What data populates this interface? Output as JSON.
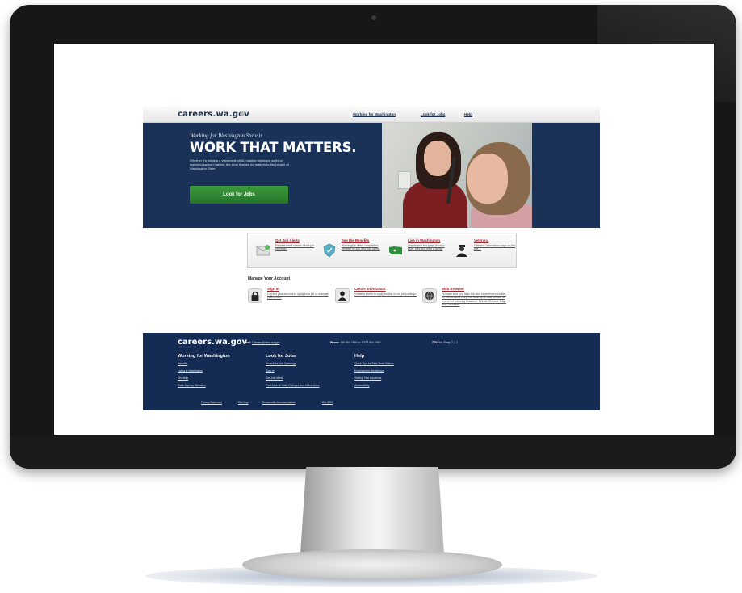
{
  "site": {
    "logo": "careers.wa.gov",
    "nav": [
      "Working for Washington",
      "Look for Jobs",
      "Help"
    ],
    "hero": {
      "subtitle": "Working for Washington State is",
      "title": "WORK THAT MATTERS.",
      "text": "Whether it's helping a vulnerable child, making highways safer or restoring salmon habitat, the work that we do matters to the people of Washington State.",
      "cta": "Look for Jobs"
    },
    "features": [
      {
        "title": "Get Job Alerts",
        "desc": "Receive email notices about job openings."
      },
      {
        "title": "See the Benefits",
        "desc": "Washington offers competitive benefits for you and your family."
      },
      {
        "title": "Live in Washington",
        "desc": "Washington is a great place to work, play and raise a family."
      },
      {
        "title": "Veterans",
        "desc": "Veterans' information page on this site ..."
      }
    ],
    "account": {
      "title": "Manage Your Account",
      "items": [
        {
          "title": "Sign In",
          "desc": "Log into your account to apply for a job or manage your profile."
        },
        {
          "title": "Create an Account",
          "desc": "Create a profile to apply for any of our job postings."
        },
        {
          "title": "Web Browser",
          "desc": "To make sure you have the best experience possible, we recommend using the most up-to-date version of one of the following browsers: Firefox, Chrome, Edge and Chromium"
        }
      ]
    },
    "footer": {
      "logo": "careers.wa.gov",
      "email_label": "Email:",
      "email": "Careers@dshs.wa.gov",
      "phone_label": "Phone:",
      "phone": "360-664-1960 or 1-877-664-1960",
      "tty_label": "TTY:",
      "tty": "WA Relay 7-1-1",
      "columns": [
        {
          "title": "Working for Washington",
          "items": [
            "Benefits",
            "Living in Washington",
            "Diversity",
            "State Agency Websites"
          ]
        },
        {
          "title": "Look for Jobs",
          "items": [
            "Search for Job Openings",
            "Sign In",
            "Get Job Alerts",
            "Find Jobs at State Colleges and Universities"
          ]
        },
        {
          "title": "Help",
          "items": [
            "Quick Tips for First-Time Visitors",
            "Employment Workshops",
            "Testing Test Locations",
            "Accessibility"
          ]
        }
      ],
      "links": [
        "Privacy Statement",
        "Site Map",
        "Reasonable Accommodation",
        "WA.GOV"
      ]
    }
  },
  "colors": {
    "navy": "#1b3258",
    "green": "#3c9a3a",
    "link_red": "#a3262b"
  }
}
